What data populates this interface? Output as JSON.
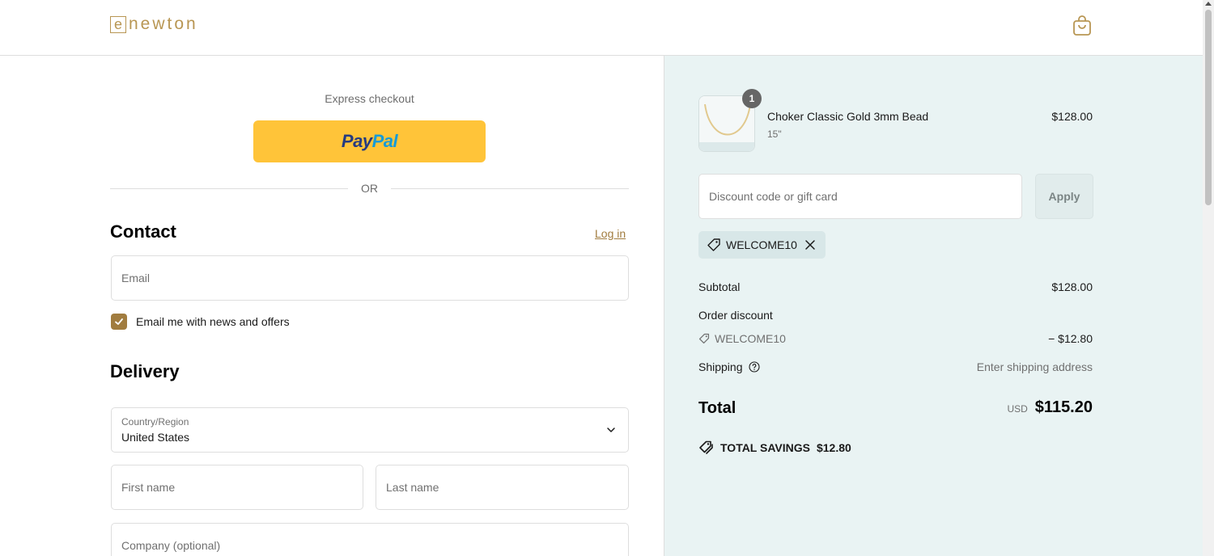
{
  "header": {
    "logo_letter": "e",
    "logo_text": "newton",
    "cart_icon": "shopping-bag-icon",
    "brand_color": "#b89653"
  },
  "checkout": {
    "express_title": "Express checkout",
    "paypal": {
      "pay": "Pay",
      "pal": "Pal"
    },
    "or": "OR",
    "contact": {
      "title": "Contact",
      "login": "Log in",
      "email_placeholder": "Email",
      "newsletter_label": "Email me with news and offers",
      "newsletter_checked": true
    },
    "delivery": {
      "title": "Delivery",
      "country_label": "Country/Region",
      "country_value": "United States",
      "first_name_placeholder": "First name",
      "last_name_placeholder": "Last name",
      "company_placeholder": "Company (optional)"
    }
  },
  "summary": {
    "item": {
      "quantity": "1",
      "name": "Choker Classic Gold 3mm Bead",
      "variant": "15\"",
      "price": "$128.00"
    },
    "discount_placeholder": "Discount code or gift card",
    "apply_label": "Apply",
    "applied_code": "WELCOME10",
    "subtotal_label": "Subtotal",
    "subtotal_value": "$128.00",
    "order_discount_label": "Order discount",
    "discount_code": "WELCOME10",
    "discount_value": "− $12.80",
    "shipping_label": "Shipping",
    "shipping_value": "Enter shipping address",
    "total_label": "Total",
    "currency": "USD",
    "total_value": "$115.20",
    "savings_label": "TOTAL SAVINGS",
    "savings_value": "$12.80",
    "panel_color": "#e9f3f3"
  }
}
